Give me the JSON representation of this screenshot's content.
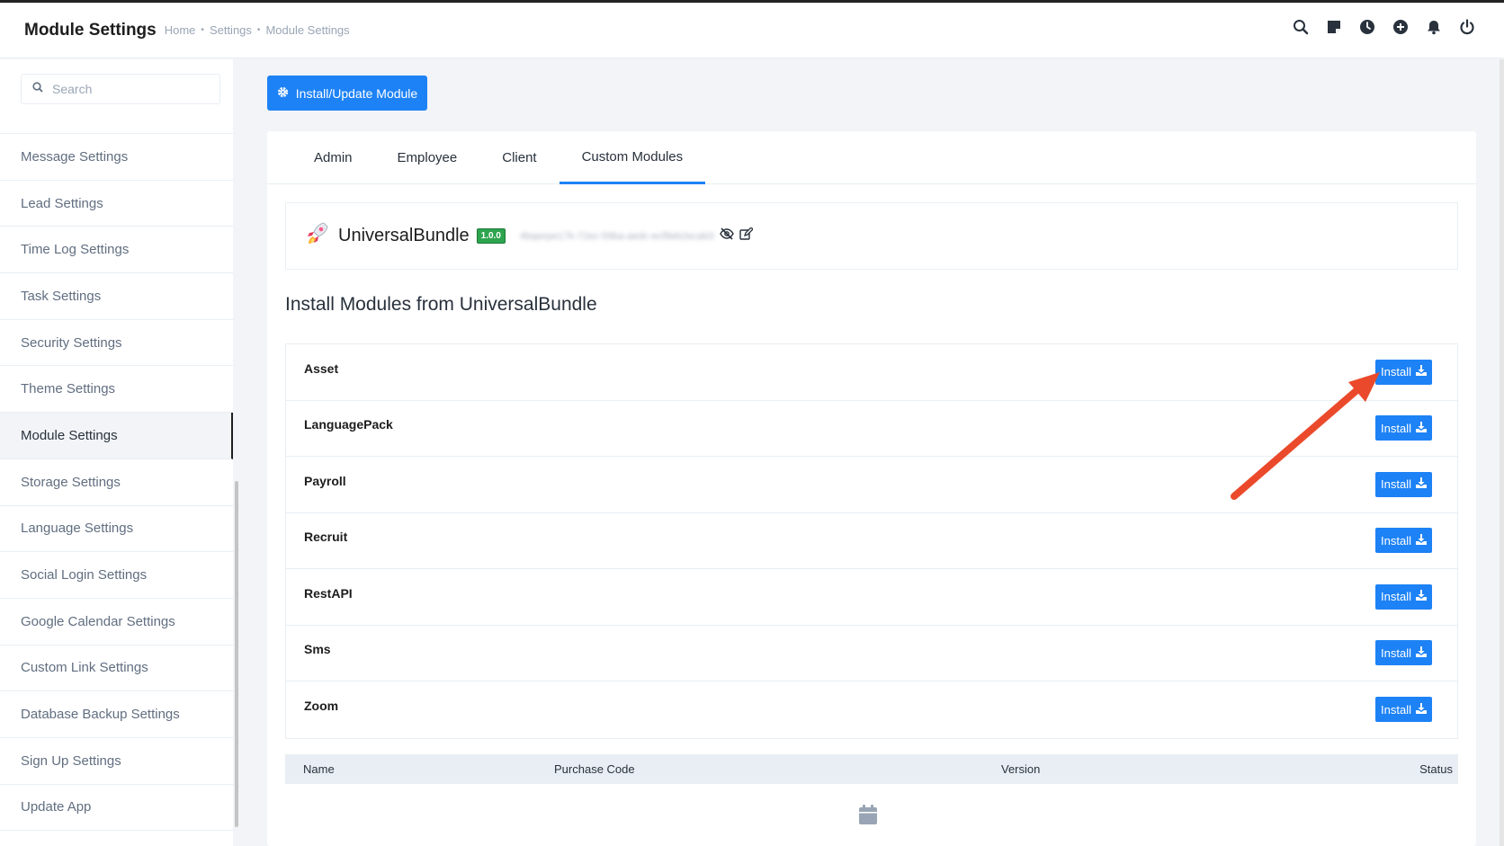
{
  "header": {
    "title": "Module Settings",
    "breadcrumb": [
      "Home",
      "Settings",
      "Module Settings"
    ],
    "icons": [
      "search-icon",
      "sticky-note-icon",
      "clock-icon",
      "plus-circle-icon",
      "bell-icon",
      "power-icon"
    ]
  },
  "sidebar": {
    "search_placeholder": "Search",
    "items": [
      {
        "label": "Message Settings"
      },
      {
        "label": "Lead Settings"
      },
      {
        "label": "Time Log Settings"
      },
      {
        "label": "Task Settings"
      },
      {
        "label": "Security Settings"
      },
      {
        "label": "Theme Settings"
      },
      {
        "label": "Module Settings",
        "active": true
      },
      {
        "label": "Storage Settings"
      },
      {
        "label": "Language Settings"
      },
      {
        "label": "Social Login Settings"
      },
      {
        "label": "Google Calendar Settings"
      },
      {
        "label": "Custom Link Settings"
      },
      {
        "label": "Database Backup Settings"
      },
      {
        "label": "Sign Up Settings"
      },
      {
        "label": "Update App"
      }
    ]
  },
  "main": {
    "install_update_label": "Install/Update Module",
    "tabs": [
      {
        "label": "Admin"
      },
      {
        "label": "Employee"
      },
      {
        "label": "Client"
      },
      {
        "label": "Custom Modules",
        "active": true
      }
    ],
    "bundle": {
      "name": "UniversalBundle",
      "version": "1.0.0",
      "license_masked": "4bqwrpe17k-72ec-59ba-aedc-ecf8eb2ecab3"
    },
    "section_title": "Install Modules from UniversalBundle",
    "install_label": "Install",
    "modules": [
      {
        "name": "Asset"
      },
      {
        "name": "LanguagePack"
      },
      {
        "name": "Payroll"
      },
      {
        "name": "Recruit"
      },
      {
        "name": "RestAPI"
      },
      {
        "name": "Sms"
      },
      {
        "name": "Zoom"
      }
    ],
    "table": {
      "columns": [
        "Name",
        "Purchase Code",
        "Version",
        "Status"
      ]
    }
  },
  "colors": {
    "primary": "#1d82f5",
    "badge_green": "#2ea44f",
    "arrow": "#ea4a2b"
  }
}
